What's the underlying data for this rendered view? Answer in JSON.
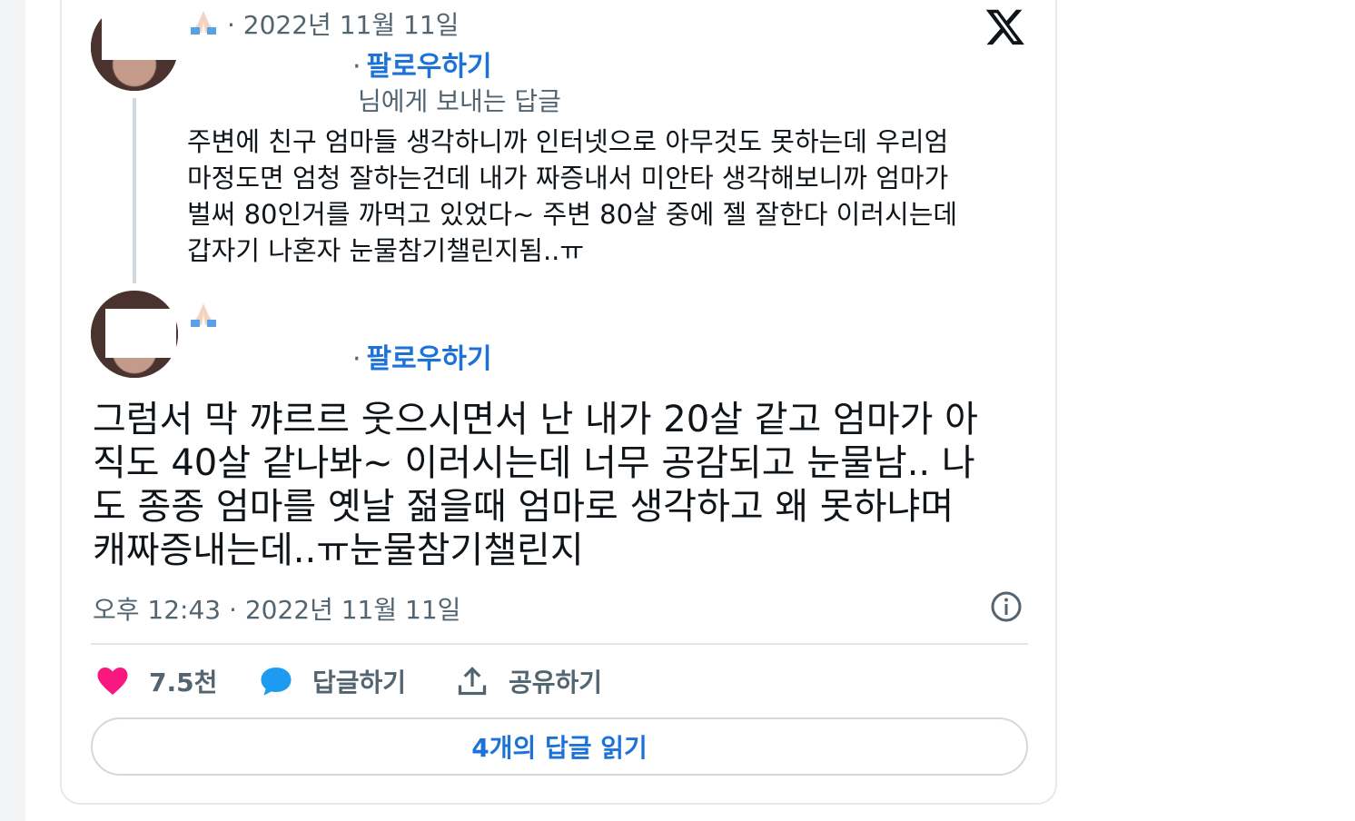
{
  "brand": {
    "logo_icon": "x-logo-icon"
  },
  "reply_tweet": {
    "emoji": "folded-hands-emoji",
    "date": "· 2022년 11월 11일",
    "follow_label": "팔로우하기",
    "reply_to_suffix": "님에게 보내는 답글",
    "text": "주변에 친구 엄마들 생각하니까 인터넷으로 아무것도 못하는데 우리엄\n마정도면 엄청 잘하는건데 내가 짜증내서 미안타 생각해보니까 엄마가\n벌써 80인거를 까먹고 있었다~ 주변 80살 중에 젤 잘한다 이러시는데\n갑자기 나혼자 눈물참기챌린지됨..ㅠ"
  },
  "main_tweet": {
    "emoji": "folded-hands-emoji",
    "follow_label": "팔로우하기",
    "text": "그럼서 막 꺄르르 웃으시면서 난 내가 20살 같고 엄마가 아\n직도 40살 같나봐~ 이러시는데 너무 공감되고 눈물남.. 나\n도 종종 엄마를 옛날 젊을때 엄마로 생각하고 왜 못하냐며\n캐짜증내는데..ㅠ눈물참기챌린지",
    "timestamp": "오후 12:43 · 2022년 11월 11일"
  },
  "actions": {
    "like_count": "7.5천",
    "reply_label": "답글하기",
    "share_label": "공유하기"
  },
  "read_replies_label": "4개의 답글 읽기",
  "colors": {
    "link_blue": "#1d72d8",
    "like_pink": "#f91880",
    "reply_blue": "#1d9bf0",
    "meta_gray": "#536471"
  }
}
